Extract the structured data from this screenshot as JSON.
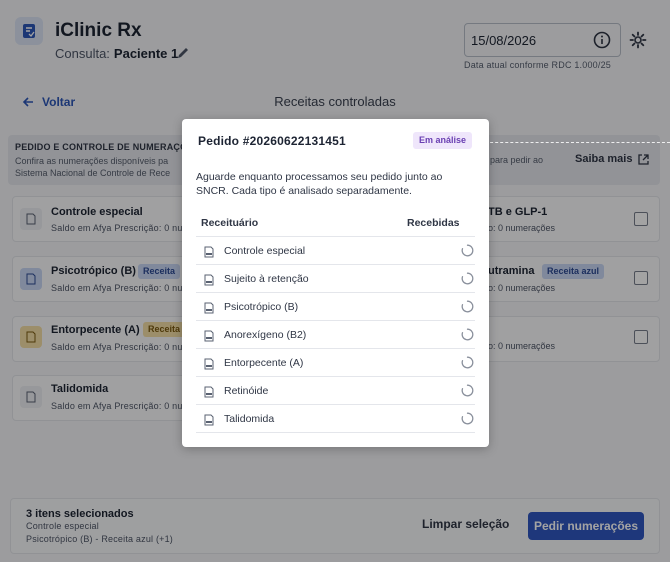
{
  "header": {
    "app_title": "iClinic Rx",
    "consult_label": "Consulta:",
    "patient": "Paciente 1",
    "date": "15/08/2026",
    "date_help": "Data atual conforme RDC 1.000/25"
  },
  "nav": {
    "back_label": "Voltar",
    "page_title": "Receitas controladas"
  },
  "banner": {
    "title": "PEDIDO E CONTROLE DE NUMERAÇÕES",
    "text_line1": "Confira as numerações disponíveis pa",
    "text_line2": "Sistema Nacional de Controle de Rece",
    "text_right": "para pedir ao",
    "link": "Saiba mais"
  },
  "cards_left": [
    {
      "name": "Controle especial",
      "sub": "Saldo em Afya Prescrição: 0 nu",
      "badge": ""
    },
    {
      "name": "Psicotrópico (B)",
      "sub": "Saldo em Afya Prescrição: 0 nu",
      "badge": "Receita"
    },
    {
      "name": "Entorpecente (A)",
      "sub": "Saldo em Afya Prescrição: 0 nu",
      "badge": "Receita"
    },
    {
      "name": "Talidomida",
      "sub": "Saldo em Afya Prescrição: 0 nu",
      "badge": ""
    }
  ],
  "cards_right": [
    {
      "name": "TB e GLP-1",
      "sub": "o: 0 numerações",
      "badge": ""
    },
    {
      "name": "utramina",
      "sub": "o: 0 numerações",
      "badge": "Receita azul"
    },
    {
      "name": "",
      "sub": "o: 0 numerações",
      "badge": ""
    }
  ],
  "footer": {
    "count": "3 itens selecionados",
    "line1": "Controle especial",
    "line2": "Psicotrópico (B) - Receita azul (+1)",
    "clear_label": "Limpar seleção",
    "request_label": "Pedir numerações"
  },
  "modal": {
    "title": "Pedido #20260622131451",
    "status": "Em análise",
    "message": "Aguarde enquanto processamos seu pedido junto ao SNCR. Cada tipo é analisado separadamente.",
    "col_recipe": "Receituário",
    "col_received": "Recebidas",
    "rows": [
      {
        "label": "Controle especial",
        "icon": "prescription-icon"
      },
      {
        "label": "Sujeito à retenção",
        "icon": "prescription-icon"
      },
      {
        "label": "Psicotrópico (B)",
        "icon": "prescription-icon"
      },
      {
        "label": "Anorexígeno (B2)",
        "icon": "prescription-icon"
      },
      {
        "label": "Entorpecente (A)",
        "icon": "prescription-icon"
      },
      {
        "label": "Retinóide",
        "icon": "prescription-icon"
      },
      {
        "label": "Talidomida",
        "icon": "prescription-icon"
      }
    ]
  },
  "colors": {
    "accent": "#2f57c0",
    "status_bg": "#efe6fb",
    "status_text": "#6a3fb2",
    "badge_blue": "#c8d6f4",
    "badge_yellow": "#f5dfa6"
  }
}
